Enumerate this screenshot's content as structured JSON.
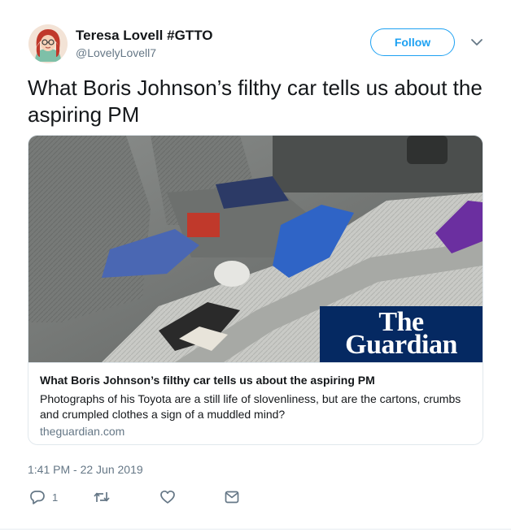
{
  "author": {
    "name": "Teresa Lovell #GTTO",
    "handle": "@LovelyLovell7"
  },
  "follow_label": "Follow",
  "tweet_text": "What Boris Johnson’s filthy car tells us about the aspiring PM",
  "card": {
    "logo_line1": "The",
    "logo_line2": "Guardian",
    "title": "What Boris Johnson’s filthy car tells us about the aspiring PM",
    "description": "Photographs of his Toyota are a still life of slovenliness, but are the cartons, crumbs and crumpled clothes a sign of a muddled mind?",
    "domain": "theguardian.com"
  },
  "timestamp": "1:41 PM - 22 Jun 2019",
  "actions": {
    "reply_count": "1"
  },
  "icons": {
    "more": "chevron-down-icon",
    "reply": "reply-icon",
    "retweet": "retweet-icon",
    "like": "heart-icon",
    "message": "envelope-icon"
  },
  "colors": {
    "accent": "#1da1f2",
    "guardian_blue": "#052962",
    "secondary_text": "#657786",
    "border": "#e1e8ed"
  }
}
